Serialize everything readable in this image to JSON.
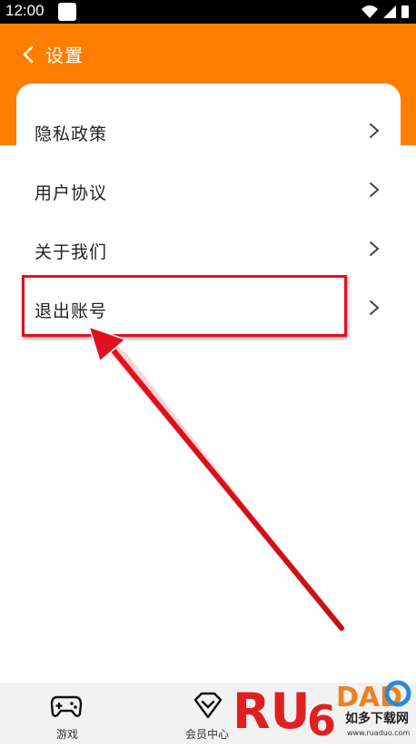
{
  "status": {
    "time": "12:00"
  },
  "header": {
    "title": "设置"
  },
  "menu": [
    {
      "label": "隐私政策"
    },
    {
      "label": "用户协议"
    },
    {
      "label": "关于我们"
    },
    {
      "label": "退出账号"
    }
  ],
  "bottom_nav": [
    {
      "label": "游戏",
      "icon": "gamepad-icon"
    },
    {
      "label": "会员中心",
      "icon": "diamond-heart-icon"
    }
  ],
  "colors": {
    "accent": "#fd7e00",
    "highlight": "#e01020"
  },
  "watermark": {
    "brand": "RUAODUO",
    "tagline": "如多下载网",
    "url": "www.ruaduo.com"
  }
}
